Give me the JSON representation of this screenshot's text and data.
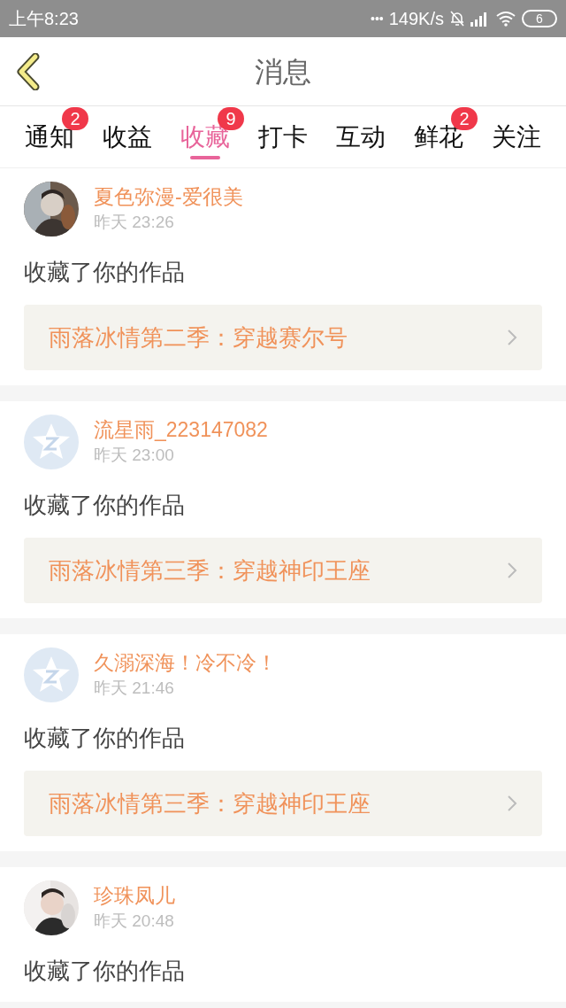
{
  "status_bar": {
    "time": "上午8:23",
    "dots": "•••",
    "speed": "149K/s",
    "battery": "6"
  },
  "header": {
    "title": "消息"
  },
  "tabs": [
    {
      "label": "通知",
      "selected": false,
      "badge": "2"
    },
    {
      "label": "收益",
      "selected": false
    },
    {
      "label": "收藏",
      "selected": true,
      "badge": "9"
    },
    {
      "label": "打卡",
      "selected": false
    },
    {
      "label": "互动",
      "selected": false
    },
    {
      "label": "鲜花",
      "selected": false,
      "badge": "2"
    },
    {
      "label": "关注",
      "selected": false
    }
  ],
  "messages": [
    {
      "user": "夏色弥漫-爱很美",
      "time": "昨天 23:26",
      "action": "收藏了你的作品",
      "work": "雨落冰情第二季：穿越赛尔号"
    },
    {
      "user": "流星雨_223147082",
      "time": "昨天 23:00",
      "avatar": {
        "kind": "default"
      },
      "action": "收藏了你的作品",
      "work": "雨落冰情第三季：穿越神印王座"
    },
    {
      "user": "久溺深海！冷不冷！",
      "time": "昨天 21:46",
      "avatar": {
        "kind": "default"
      },
      "action": "收藏了你的作品",
      "work": "雨落冰情第三季：穿越神印王座"
    },
    {
      "user": "珍珠凤儿",
      "time": "昨天 20:48",
      "action": "收藏了你的作品"
    }
  ]
}
